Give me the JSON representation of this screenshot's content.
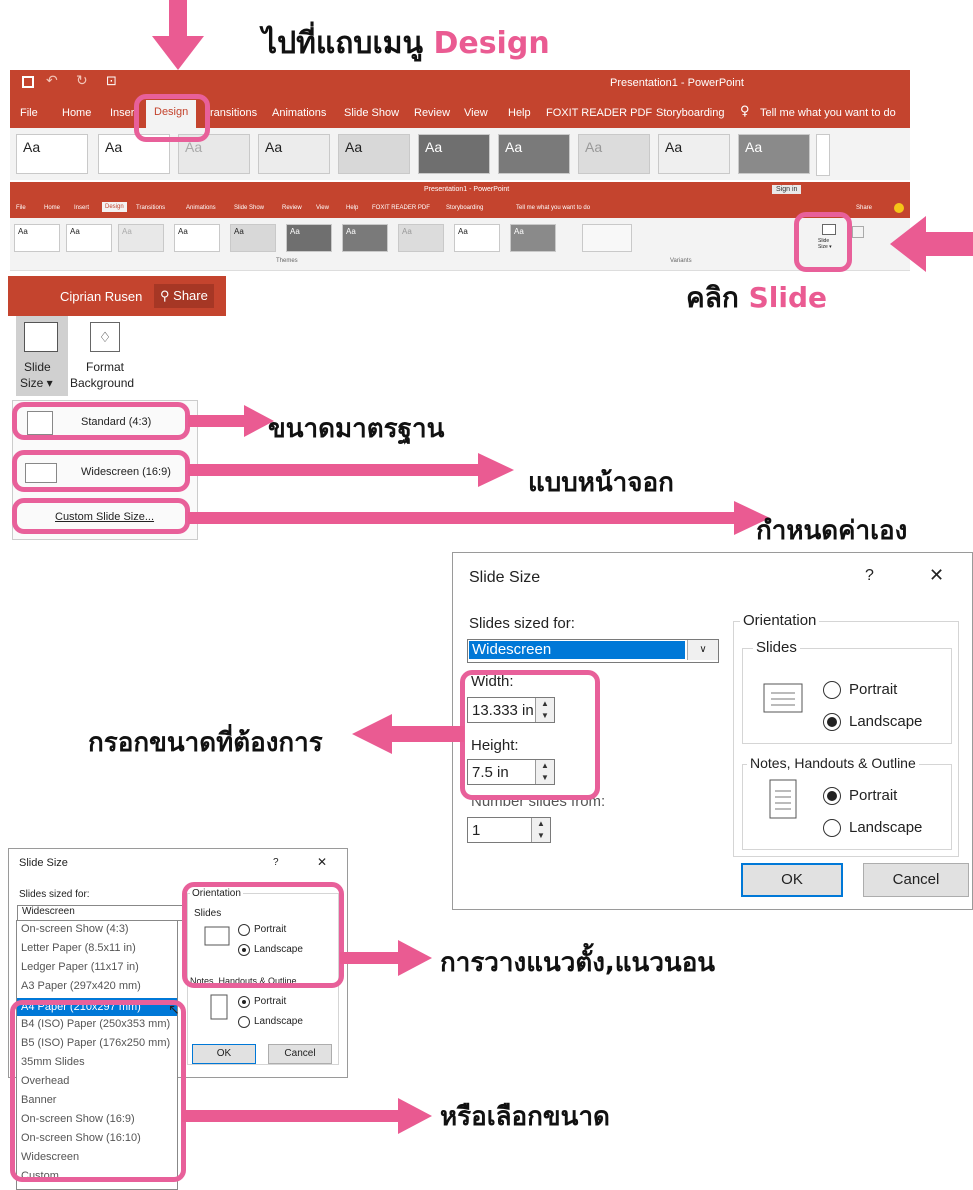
{
  "annotations": {
    "goto_design_prefix": "ไปที่แถบเมนู",
    "goto_design_word": "Design",
    "click_prefix": "คลิก",
    "click_word": "Slide",
    "standard_note": "ขนาดมาตรฐาน",
    "widescreen_note": "แบบหน้าจอก",
    "custom_note": "กำหนดค่าเอง",
    "enter_size_note": "กรอกขนาดที่ต้องการ",
    "orientation_note": "การวางแนวตั้ง,แนวนอน",
    "choose_size_note": "หรือเลือกขนาด"
  },
  "colors": {
    "accent": "#ea5b92",
    "ribbon": "#c4442e",
    "selection": "#0078d7"
  },
  "ribbon_large": {
    "title": "Presentation1  -  PowerPoint",
    "tabs": [
      "File",
      "Home",
      "Inser",
      "Design",
      "ransitions",
      "Animations",
      "Slide Show",
      "Review",
      "View",
      "Help",
      "FOXIT READER PDF",
      "Storyboarding"
    ],
    "tell_me": "Tell me what you want to do",
    "theme_label": "Aa"
  },
  "ribbon_small": {
    "title": "Presentation1 - PowerPoint",
    "sign_in": "Sign in",
    "share": "Share",
    "tabs": [
      "File",
      "Home",
      "Insert",
      "Design",
      "Transitions",
      "Animations",
      "Slide Show",
      "Review",
      "View",
      "Help",
      "FOXIT READER PDF",
      "Storyboarding"
    ],
    "tell_me": "Tell me what you want to do",
    "themes_group": "Themes",
    "variants_group": "Variants",
    "slide_size_label": "Slide Size",
    "format_bg_label": "Format Background"
  },
  "dropdown_panel": {
    "user_name": "Ciprian Rusen",
    "share": "Share",
    "slide_size_label_1": "Slide",
    "slide_size_label_2": "Size",
    "format_bg_label_1": "Format",
    "format_bg_label_2": "Background",
    "options": [
      "Standard (4:3)",
      "Widescreen (16:9)",
      "Custom Slide Size..."
    ]
  },
  "slide_size_dialog": {
    "title": "Slide Size",
    "help": "?",
    "close": "✕",
    "sized_for_label": "Slides sized for:",
    "sized_for_value": "Widescreen",
    "width_label": "Width:",
    "width_value": "13.333 in",
    "height_label": "Height:",
    "height_value": "7.5 in",
    "number_from_label": "Number slides from:",
    "number_from_value": "1",
    "orientation_label": "Orientation",
    "slides_label": "Slides",
    "portrait": "Portrait",
    "landscape": "Landscape",
    "notes_label": "Notes, Handouts & Outline",
    "ok": "OK",
    "cancel": "Cancel"
  },
  "small_dialog": {
    "title": "Slide Size",
    "help": "?",
    "close": "✕",
    "sized_for_label": "Slides sized for:",
    "sized_for_value": "Widescreen",
    "orientation_label": "Orientation",
    "slides_label": "Slides",
    "portrait": "Portrait",
    "landscape": "Landscape",
    "notes_label": "Notes, Handouts & Outline",
    "ok": "OK",
    "cancel": "Cancel",
    "size_options": [
      "On-screen Show (4:3)",
      "Letter Paper (8.5x11 in)",
      "Ledger Paper (11x17 in)",
      "A3 Paper (297x420 mm)",
      "A4 Paper (210x297 mm)",
      "B4 (ISO) Paper (250x353 mm)",
      "B5 (ISO) Paper (176x250 mm)",
      "35mm Slides",
      "Overhead",
      "Banner",
      "On-screen Show (16:9)",
      "On-screen Show (16:10)",
      "Widescreen",
      "Custom"
    ],
    "selected_option": "A4 Paper (210x297 mm)"
  }
}
